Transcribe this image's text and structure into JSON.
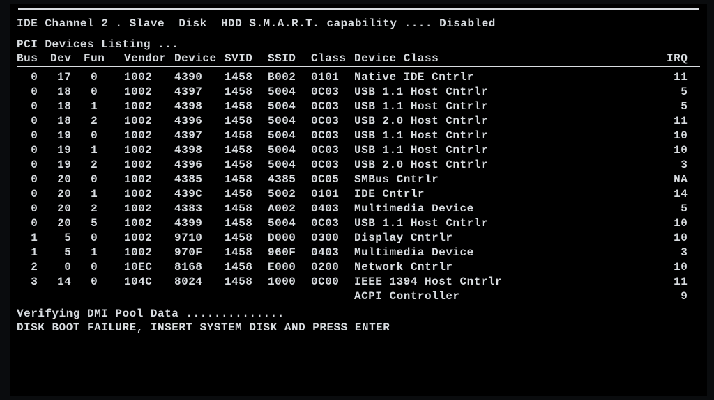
{
  "top_status": "IDE Channel 2 . Slave  Disk  HDD S.M.A.R.T. capability .... Disabled",
  "listing_title": "PCI Devices Listing ...",
  "columns": {
    "bus": "Bus",
    "dev": "Dev",
    "fun": "Fun",
    "vendor": "Vendor",
    "device": "Device",
    "svid": "SVID",
    "ssid": "SSID",
    "class": "Class",
    "device_class": "Device Class",
    "irq": "IRQ"
  },
  "rows": [
    {
      "bus": "0",
      "dev": "17",
      "fun": "0",
      "vendor": "1002",
      "device": "4390",
      "svid": "1458",
      "ssid": "B002",
      "class": "0101",
      "device_class": "Native IDE Cntrlr",
      "irq": "11"
    },
    {
      "bus": "0",
      "dev": "18",
      "fun": "0",
      "vendor": "1002",
      "device": "4397",
      "svid": "1458",
      "ssid": "5004",
      "class": "0C03",
      "device_class": "USB 1.1 Host Cntrlr",
      "irq": "5"
    },
    {
      "bus": "0",
      "dev": "18",
      "fun": "1",
      "vendor": "1002",
      "device": "4398",
      "svid": "1458",
      "ssid": "5004",
      "class": "0C03",
      "device_class": "USB 1.1 Host Cntrlr",
      "irq": "5"
    },
    {
      "bus": "0",
      "dev": "18",
      "fun": "2",
      "vendor": "1002",
      "device": "4396",
      "svid": "1458",
      "ssid": "5004",
      "class": "0C03",
      "device_class": "USB 2.0 Host Cntrlr",
      "irq": "11"
    },
    {
      "bus": "0",
      "dev": "19",
      "fun": "0",
      "vendor": "1002",
      "device": "4397",
      "svid": "1458",
      "ssid": "5004",
      "class": "0C03",
      "device_class": "USB 1.1 Host Cntrlr",
      "irq": "10"
    },
    {
      "bus": "0",
      "dev": "19",
      "fun": "1",
      "vendor": "1002",
      "device": "4398",
      "svid": "1458",
      "ssid": "5004",
      "class": "0C03",
      "device_class": "USB 1.1 Host Cntrlr",
      "irq": "10"
    },
    {
      "bus": "0",
      "dev": "19",
      "fun": "2",
      "vendor": "1002",
      "device": "4396",
      "svid": "1458",
      "ssid": "5004",
      "class": "0C03",
      "device_class": "USB 2.0 Host Cntrlr",
      "irq": "3"
    },
    {
      "bus": "0",
      "dev": "20",
      "fun": "0",
      "vendor": "1002",
      "device": "4385",
      "svid": "1458",
      "ssid": "4385",
      "class": "0C05",
      "device_class": "SMBus Cntrlr",
      "irq": "NA"
    },
    {
      "bus": "0",
      "dev": "20",
      "fun": "1",
      "vendor": "1002",
      "device": "439C",
      "svid": "1458",
      "ssid": "5002",
      "class": "0101",
      "device_class": "IDE Cntrlr",
      "irq": "14"
    },
    {
      "bus": "0",
      "dev": "20",
      "fun": "2",
      "vendor": "1002",
      "device": "4383",
      "svid": "1458",
      "ssid": "A002",
      "class": "0403",
      "device_class": "Multimedia Device",
      "irq": "5"
    },
    {
      "bus": "0",
      "dev": "20",
      "fun": "5",
      "vendor": "1002",
      "device": "4399",
      "svid": "1458",
      "ssid": "5004",
      "class": "0C03",
      "device_class": "USB 1.1 Host Cntrlr",
      "irq": "10"
    },
    {
      "bus": "1",
      "dev": "5",
      "fun": "0",
      "vendor": "1002",
      "device": "9710",
      "svid": "1458",
      "ssid": "D000",
      "class": "0300",
      "device_class": "Display Cntrlr",
      "irq": "10"
    },
    {
      "bus": "1",
      "dev": "5",
      "fun": "1",
      "vendor": "1002",
      "device": "970F",
      "svid": "1458",
      "ssid": "960F",
      "class": "0403",
      "device_class": "Multimedia Device",
      "irq": "3"
    },
    {
      "bus": "2",
      "dev": "0",
      "fun": "0",
      "vendor": "10EC",
      "device": "8168",
      "svid": "1458",
      "ssid": "E000",
      "class": "0200",
      "device_class": "Network Cntrlr",
      "irq": "10"
    },
    {
      "bus": "3",
      "dev": "14",
      "fun": "0",
      "vendor": "104C",
      "device": "8024",
      "svid": "1458",
      "ssid": "1000",
      "class": "0C00",
      "device_class": "IEEE 1394 Host Cntrlr",
      "irq": "11"
    }
  ],
  "acpi_row": {
    "device_class": "ACPI Controller",
    "irq": "9"
  },
  "verify_line": "Verifying DMI Pool Data ..............",
  "error_line": "DISK BOOT FAILURE, INSERT SYSTEM DISK AND PRESS ENTER"
}
